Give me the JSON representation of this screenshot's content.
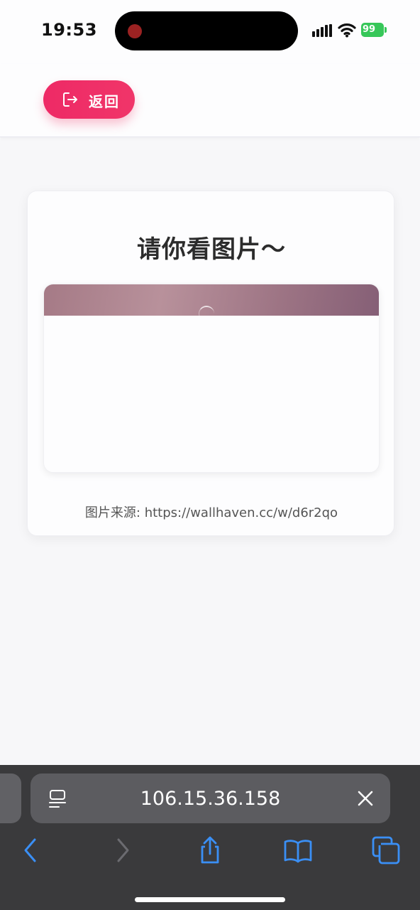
{
  "status_bar": {
    "time": "19:53",
    "battery": "99",
    "icons": [
      "recording-dot",
      "cellular-signal-icon",
      "wifi-icon",
      "battery-icon"
    ]
  },
  "header": {
    "back_label": "返回",
    "back_icon": "logout-icon"
  },
  "card": {
    "title": "请你看图片～",
    "image_alt": "wallpaper image (partially loaded)",
    "source_text": "图片来源: https://wallhaven.cc/w/d6r2qo"
  },
  "browser": {
    "url": "106.15.36.158",
    "toolbar": [
      "back-icon",
      "forward-icon",
      "share-icon",
      "bookmarks-icon",
      "tabs-icon"
    ]
  },
  "colors": {
    "accent": "#ee2a66",
    "toolbar_blue": "#3a8ff5",
    "battery_green": "#37c759"
  }
}
